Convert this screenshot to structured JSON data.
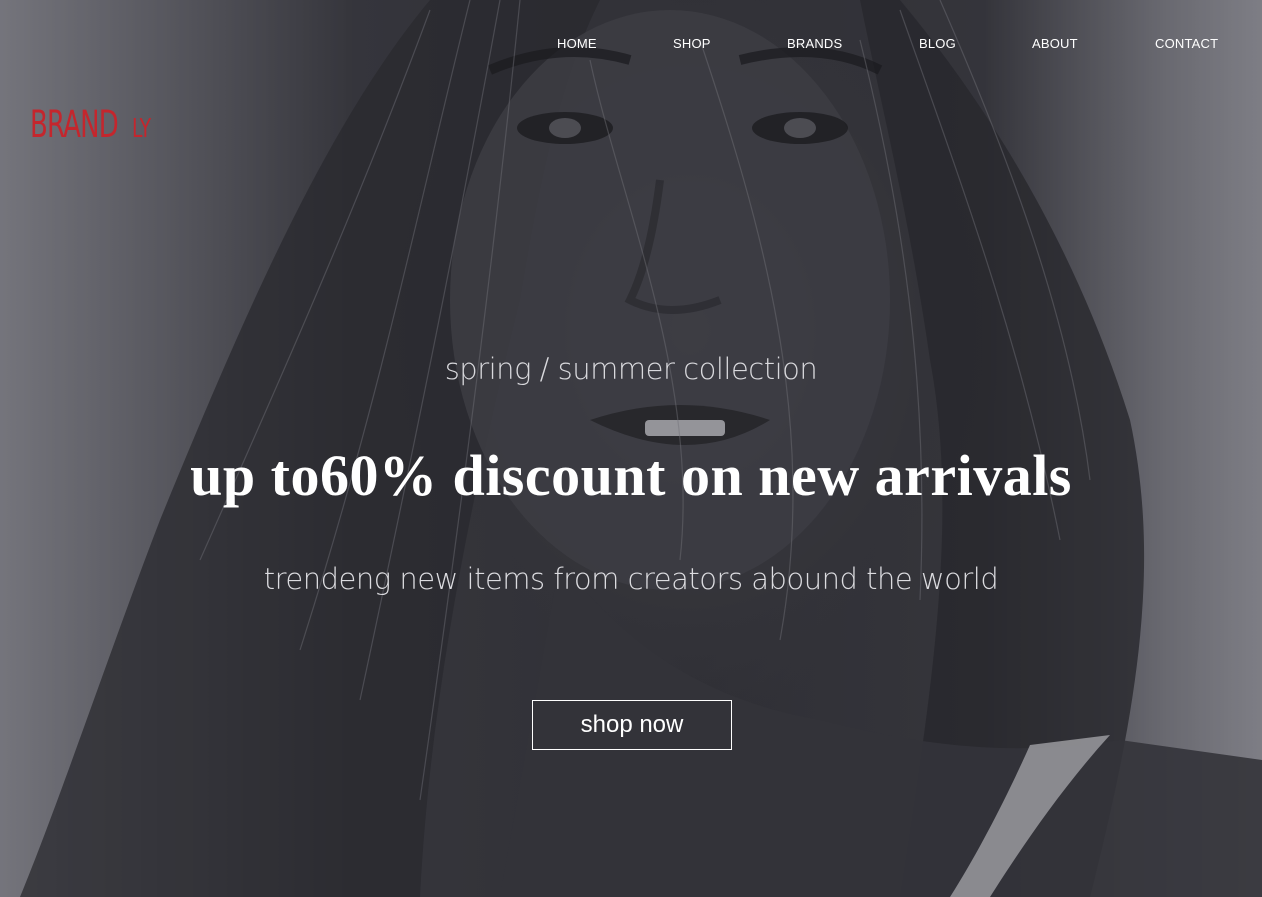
{
  "brand": {
    "name_main": "BRAND",
    "name_suffix": "LY",
    "color": "#c4262d"
  },
  "nav": {
    "items": [
      {
        "label": "HOME"
      },
      {
        "label": "SHOP"
      },
      {
        "label": "BRANDS"
      },
      {
        "label": "BLOG"
      },
      {
        "label": "ABOUT"
      },
      {
        "label": "CONTACT"
      }
    ]
  },
  "hero": {
    "image_icon": "hero-portrait-image",
    "subtitle": "spring / summer collection",
    "headline": "up to60% discount on new arrivals",
    "tagline": "trendeng new items from creators abound the world",
    "cta_label": "shop now"
  }
}
